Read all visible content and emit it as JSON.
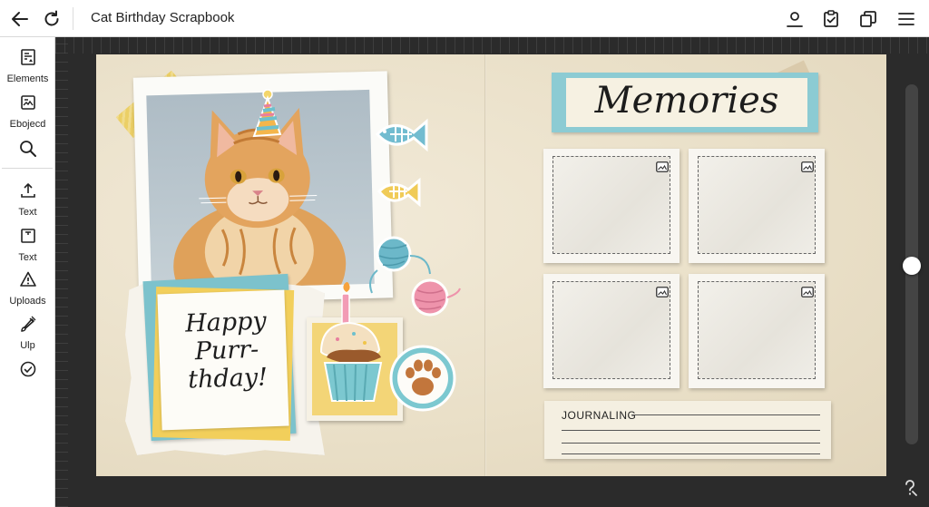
{
  "app": {
    "title": "Cat Birthday Scrapbook"
  },
  "topbar": {
    "icons": [
      "back-arrow-icon",
      "refresh-icon",
      "account-icon",
      "clipboard-check-icon",
      "duplicate-icon",
      "menu-icon"
    ]
  },
  "sidebar": {
    "items": [
      {
        "label": "Elements",
        "icon": "elements-icon"
      },
      {
        "label": "Ebojecd",
        "icon": "image-box-icon"
      },
      {
        "label": "",
        "icon": "search-icon"
      },
      {
        "label": "Text",
        "icon": "upload-text-icon"
      },
      {
        "label": "Text",
        "icon": "text-frame-icon"
      },
      {
        "label": "Uploads",
        "icon": "warning-triangle-icon"
      },
      {
        "label": "Ulp",
        "icon": "brush-icon"
      },
      {
        "label": "",
        "icon": "check-circle-icon"
      }
    ]
  },
  "page": {
    "left": {
      "greeting": [
        "Happy",
        "Purr-",
        "thday!"
      ]
    },
    "right": {
      "banner_title": "Memories",
      "journal_label": "JOURNALING"
    }
  },
  "colors": {
    "teal": "#8ccbd3",
    "yellow": "#f2cf5b",
    "paper": "#efe6d1",
    "canvas": "#2b2b2b"
  }
}
